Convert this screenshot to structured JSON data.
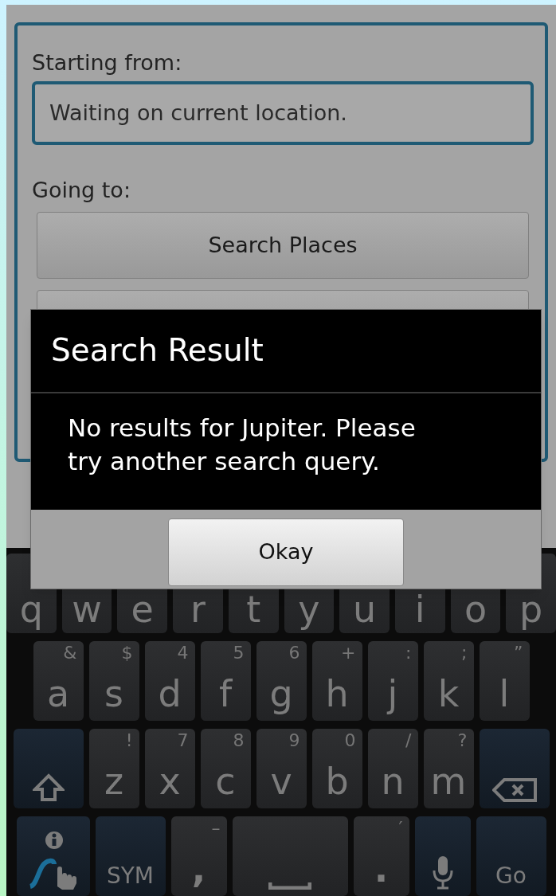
{
  "form": {
    "starting_label": "Starting from:",
    "starting_field": {
      "value": "Waiting on current location."
    },
    "going_label": "Going to:",
    "buttons": [
      {
        "kind": "labeled",
        "label": "Search Places"
      },
      {
        "kind": "covered"
      }
    ]
  },
  "dialog": {
    "title": "Search Result",
    "message": "No results for Jupiter. Please try another search query.",
    "buttons": [
      "Okay"
    ]
  },
  "keyboard": {
    "rows": [
      {
        "keys": [
          {
            "kind": "letter",
            "label": "q"
          },
          {
            "kind": "letter",
            "label": "w"
          },
          {
            "kind": "letter",
            "label": "e"
          },
          {
            "kind": "letter",
            "label": "r"
          },
          {
            "kind": "letter",
            "label": "t"
          },
          {
            "kind": "letter",
            "label": "y"
          },
          {
            "kind": "letter",
            "label": "u"
          },
          {
            "kind": "letter",
            "label": "i"
          },
          {
            "kind": "letter",
            "label": "o"
          },
          {
            "kind": "letter",
            "label": "p"
          }
        ]
      },
      {
        "keys": [
          {
            "kind": "letter",
            "label": "a",
            "hint": "&"
          },
          {
            "kind": "letter",
            "label": "s",
            "hint": "$"
          },
          {
            "kind": "letter",
            "label": "d",
            "hint": "4"
          },
          {
            "kind": "letter",
            "label": "f",
            "hint": "5"
          },
          {
            "kind": "letter",
            "label": "g",
            "hint": "6"
          },
          {
            "kind": "letter",
            "label": "h",
            "hint": "+"
          },
          {
            "kind": "letter",
            "label": "j",
            "hint": ":"
          },
          {
            "kind": "letter",
            "label": "k",
            "hint": ";"
          },
          {
            "kind": "letter",
            "label": "l",
            "hint": "”"
          }
        ]
      },
      {
        "keys": [
          {
            "kind": "shift"
          },
          {
            "kind": "letter",
            "label": "z",
            "hint": "!"
          },
          {
            "kind": "letter",
            "label": "x",
            "hint": "7"
          },
          {
            "kind": "letter",
            "label": "c",
            "hint": "8"
          },
          {
            "kind": "letter",
            "label": "v",
            "hint": "9"
          },
          {
            "kind": "letter",
            "label": "b",
            "hint": "0"
          },
          {
            "kind": "letter",
            "label": "n",
            "hint": "/"
          },
          {
            "kind": "letter",
            "label": "m",
            "hint": "?"
          },
          {
            "kind": "backspace"
          }
        ]
      },
      {
        "keys": [
          {
            "kind": "swype"
          },
          {
            "kind": "text",
            "label": "SYM"
          },
          {
            "kind": "punct",
            "label": ",",
            "hint": "–"
          },
          {
            "kind": "space"
          },
          {
            "kind": "punct",
            "label": ".",
            "hint": "′"
          },
          {
            "kind": "mic"
          },
          {
            "kind": "text",
            "label": "Go"
          }
        ]
      }
    ]
  }
}
